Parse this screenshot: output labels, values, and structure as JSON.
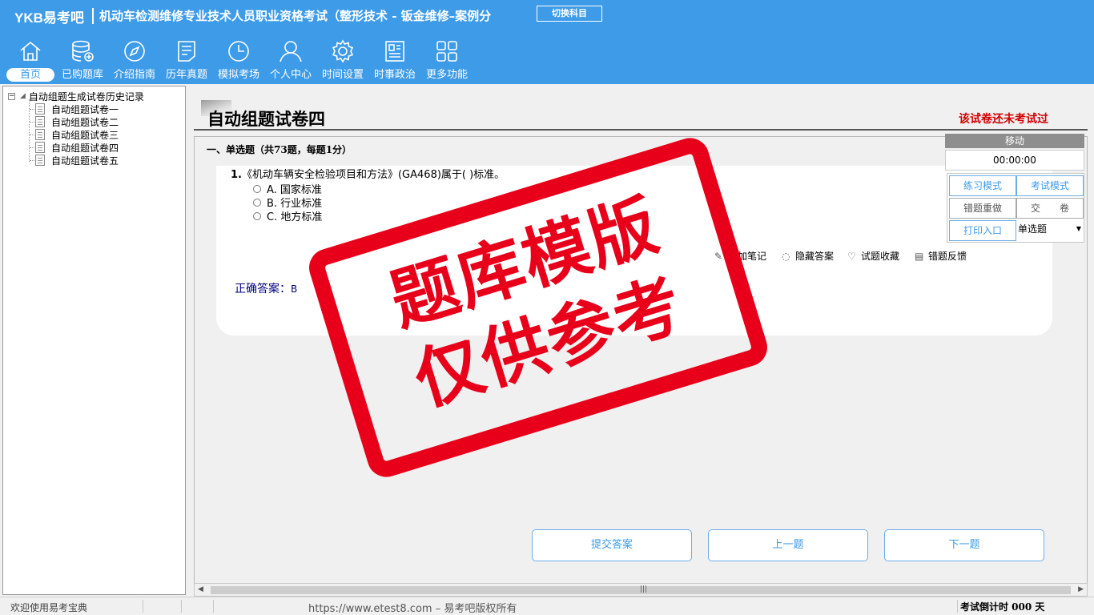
{
  "header": {
    "logo": "YKB易考吧",
    "title": "机动车检测维修专业技术人员职业资格考试（整形技术 - 钣金维修–案例分",
    "switch_subject": "切换科目"
  },
  "nav": {
    "items": [
      {
        "label": "首页",
        "icon": "home-icon"
      },
      {
        "label": "已购题库",
        "icon": "database-icon"
      },
      {
        "label": "介绍指南",
        "icon": "compass-icon"
      },
      {
        "label": "历年真题",
        "icon": "list-doc-icon"
      },
      {
        "label": "模拟考场",
        "icon": "clock-icon"
      },
      {
        "label": "个人中心",
        "icon": "user-icon"
      },
      {
        "label": "时间设置",
        "icon": "gear-icon"
      },
      {
        "label": "时事政治",
        "icon": "newspaper-icon"
      },
      {
        "label": "更多功能",
        "icon": "grid-icon"
      }
    ]
  },
  "tree": {
    "root": "自动组题生成试卷历史记录",
    "items": [
      "自动组题试卷一",
      "自动组题试卷二",
      "自动组题试卷三",
      "自动组题试卷四",
      "自动组题试卷五"
    ]
  },
  "paper": {
    "title": "自动组题试卷四",
    "status": "该试卷还未考试过",
    "section": "一、单选题（共73题，每题1分）"
  },
  "question": {
    "number": "1.",
    "text": "《机动车辆安全检验项目和方法》(GA468)属于( )标准。",
    "options": [
      "A. 国家标准",
      "B. 行业标准",
      "C. 地方标准"
    ],
    "answer_label": "正确答案：",
    "answer_value": "B"
  },
  "tools": {
    "add_note": "添加笔记",
    "hide_answer": "隐藏答案",
    "favorite": "试题收藏",
    "report": "错题反馈"
  },
  "buttons": {
    "submit": "提交答案",
    "prev": "上一题",
    "next": "下一题"
  },
  "control": {
    "move": "移动",
    "timer": "00:00:00",
    "practice": "练习模式",
    "exam": "考试模式",
    "redo": "错题重做",
    "hand_in": "交　　卷",
    "print": "打印入口",
    "type_select": "单选题"
  },
  "stamp": {
    "line1": "题库模版",
    "line2": "仅供参考"
  },
  "status": {
    "welcome": "欢迎使用易考宝典",
    "copyright": "https://www.etest8.com – 易考吧版权所有",
    "countdown": "考试倒计时 000 天"
  },
  "colors": {
    "header": "#3d9be8",
    "stamp": "#e8001a",
    "status_red": "#d00000"
  }
}
